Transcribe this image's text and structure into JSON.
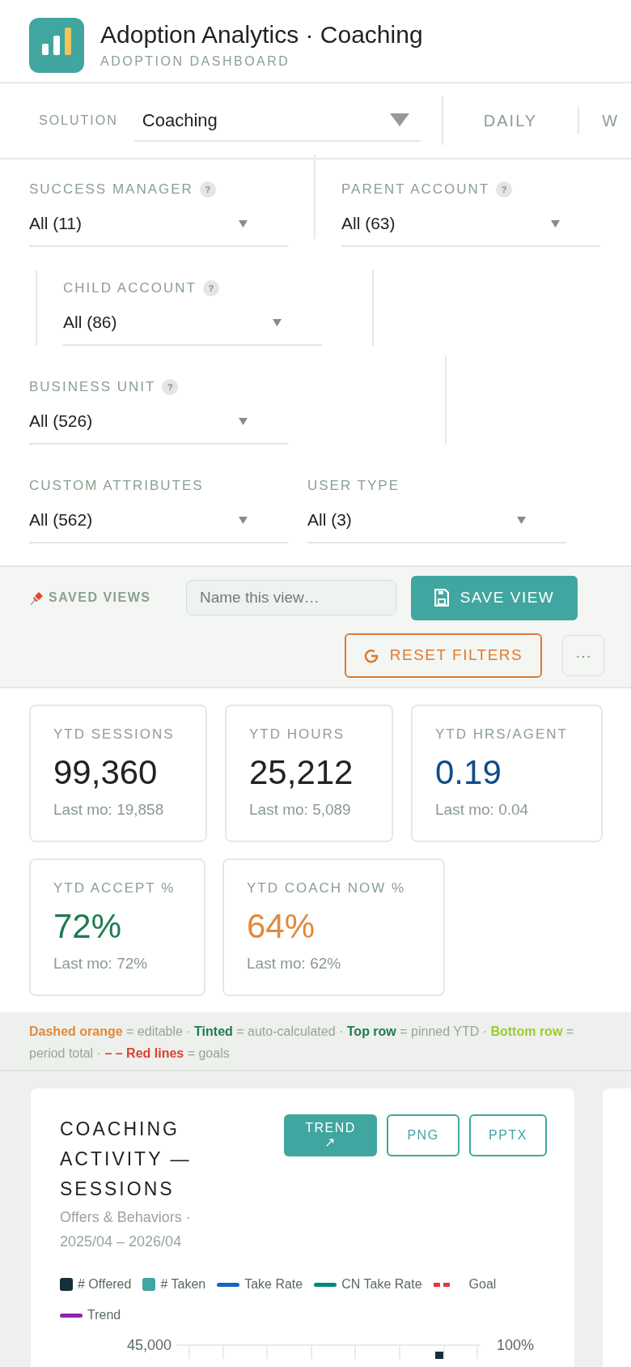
{
  "header": {
    "title": "Adoption Analytics · Coaching",
    "subtitle": "ADOPTION DASHBOARD"
  },
  "solution": {
    "label": "SOLUTION",
    "value": "Coaching"
  },
  "tabs": [
    {
      "label": "DAILY",
      "selected": false
    },
    {
      "label": "W",
      "selected": false
    }
  ],
  "filter_rows": [
    [
      {
        "label": "SUCCESS MANAGER",
        "help": "?",
        "value": "All (11)"
      },
      {
        "label": "PARENT ACCOUNT",
        "help": "?",
        "value": "All (63)"
      }
    ],
    [
      {
        "label": "CHILD ACCOUNT",
        "help": "?",
        "value": "All (86)"
      }
    ],
    [
      {
        "label": "BUSINESS UNIT",
        "help": "?",
        "value": "All (526)"
      }
    ],
    [
      {
        "label": "CUSTOM ATTRIBUTES",
        "value": "All (562)"
      },
      {
        "label": "USER TYPE",
        "value": "All (3)"
      }
    ]
  ],
  "saved_views": {
    "label": "SAVED VIEWS",
    "placeholder": "Name this view…",
    "save_button": "SAVE VIEW",
    "reset_button": "RESET FILTERS",
    "more_button": "⋯"
  },
  "kpis": [
    {
      "label": "YTD SESSIONS",
      "value": "99,360",
      "sub": "Last mo: 19,858",
      "color": "#222222"
    },
    {
      "label": "YTD HOURS",
      "value": "25,212",
      "sub": "Last mo: 5,089",
      "color": "#222222"
    },
    {
      "label": "YTD HRS/AGENT",
      "value": "0.19",
      "sub": "Last mo: 0.04",
      "color": "#0f4c8a"
    },
    {
      "label": "YTD ACCEPT %",
      "value": "72%",
      "sub": "Last mo: 72%",
      "color": "#1e7b4f"
    },
    {
      "label": "YTD COACH NOW %",
      "value": "64%",
      "sub": "Last mo: 62%",
      "color": "#e08a3c"
    }
  ],
  "note": [
    {
      "text": "Dashed orange",
      "kind": "orange"
    },
    {
      "text": " = editable · ",
      "kind": "plain"
    },
    {
      "text": "Tinted",
      "kind": "green"
    },
    {
      "text": " = auto-calculated · ",
      "kind": "plain"
    },
    {
      "text": "Top row",
      "kind": "green"
    },
    {
      "text": " = pinned YTD · ",
      "kind": "plain"
    },
    {
      "text": "Bottom row",
      "kind": "lime"
    },
    {
      "text": " = period total · ",
      "kind": "plain"
    },
    {
      "text": "– – Red lines",
      "kind": "red"
    },
    {
      "text": " = goals",
      "kind": "plain"
    }
  ],
  "chart_card": {
    "title": "COACHING ACTIVITY — SESSIONS",
    "subtitle": "Offers & Behaviors · 2025/04 – 2026/04",
    "buttons": [
      {
        "label": "TREND ↗",
        "selected": true
      },
      {
        "label": "PNG",
        "selected": false
      },
      {
        "label": "PPTX",
        "selected": false
      }
    ],
    "legend": [
      {
        "label": "# Offered",
        "kind": "box",
        "color": "#14303a"
      },
      {
        "label": "# Taken",
        "kind": "box",
        "color": "#40a69f"
      },
      {
        "label": "Take Rate",
        "kind": "line",
        "color": "#1565c0"
      },
      {
        "label": "CN Take Rate",
        "kind": "line",
        "color": "#00897b"
      },
      {
        "label": "Goal",
        "kind": "dashed",
        "color": "#e53935"
      },
      {
        "label": "Trend",
        "kind": "line",
        "color": "#8e24aa"
      }
    ],
    "left_tick": "45,000",
    "right_tick": "100%"
  }
}
